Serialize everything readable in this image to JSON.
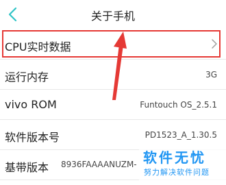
{
  "header": {
    "title": "关于手机"
  },
  "rows": [
    {
      "label": "CPU实时数据",
      "value": ""
    },
    {
      "label": "运行内存",
      "value": "3G"
    },
    {
      "label": "vivo ROM",
      "value": "Funtouch OS_2.5.1"
    },
    {
      "label": "软件版本号",
      "value": "PD1523_A_1.30.5"
    },
    {
      "label": "基带版本",
      "value": "8936FAAAANUZM-"
    }
  ],
  "watermark": {
    "title": "软件无忧",
    "subtitle": "努力解决软件问题"
  },
  "colors": {
    "accent": "#2ec4c6",
    "annotation": "#e53935",
    "watermark": "#2196f3"
  },
  "icons": {
    "back": "back-arrow-icon",
    "chevron": "chevron-right-icon"
  }
}
